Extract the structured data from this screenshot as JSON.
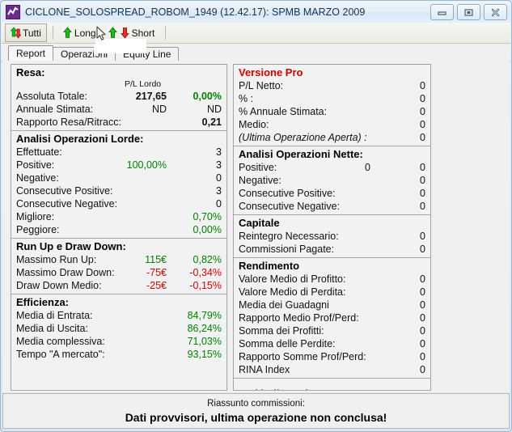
{
  "window": {
    "title": "CICLONE_SOLOSPREAD_ROBOM_1949 (12.42.17): SPMB MARZO 2009",
    "icon": "chart-line-icon",
    "buttons": {
      "minimize": "minimize-icon",
      "maximize": "maximize-icon",
      "close": "close-icon"
    }
  },
  "toolbar": {
    "items": [
      {
        "label": "Tutti",
        "icon": "up-down-arrow-icon",
        "pressed": true
      },
      {
        "label": "Long",
        "icon": "up-arrow-icon",
        "pressed": false
      },
      {
        "label": "Short",
        "icon": "up-down-arrow-icon",
        "pressed": false
      }
    ]
  },
  "tabs": [
    {
      "label": "Report",
      "active": true
    },
    {
      "label": "Operazioni",
      "active": false
    },
    {
      "label": "Equity Line",
      "active": false
    }
  ],
  "left_panel": {
    "groups": [
      {
        "heading": "Resa:",
        "col_header": "P/L Lordo",
        "rows": [
          {
            "label": "Assoluta Totale:",
            "mid": "217,65",
            "mid_bold": true,
            "val": "0,00%",
            "val_class": "green bold"
          },
          {
            "label": "Annuale Stimata:",
            "mid": "ND",
            "mid_bold": false,
            "val": "ND",
            "val_class": ""
          },
          {
            "label": "Rapporto Resa/Ritracc:",
            "mid": "",
            "mid_bold": false,
            "val": "0,21",
            "val_class": "bold"
          }
        ]
      },
      {
        "heading": "Analisi Operazioni Lorde:",
        "rows": [
          {
            "label": "Effettuate:",
            "mid": "",
            "val": "3",
            "val_class": ""
          },
          {
            "label": "Positive:",
            "mid": "100,00%",
            "mid_class": "green",
            "val": "3",
            "val_class": ""
          },
          {
            "label": "Negative:",
            "mid": "",
            "val": "0",
            "val_class": ""
          },
          {
            "label": "Consecutive Positive:",
            "mid": "",
            "val": "3",
            "val_class": ""
          },
          {
            "label": "Consecutive Negative:",
            "mid": "",
            "val": "0",
            "val_class": ""
          },
          {
            "label": "Migliore:",
            "mid": "",
            "val": "0,70%",
            "val_class": "green"
          },
          {
            "label": "Peggiore:",
            "mid": "",
            "val": "0,00%",
            "val_class": "green"
          }
        ]
      },
      {
        "heading": "Run Up e Draw Down:",
        "rows": [
          {
            "label": "Massimo Run Up:",
            "mid": "115€",
            "mid_class": "green",
            "val": "0,82%",
            "val_class": "green"
          },
          {
            "label": "Massimo Draw Down:",
            "mid": "-75€",
            "mid_class": "red",
            "val": "-0,34%",
            "val_class": "red"
          },
          {
            "label": "Draw Down Medio:",
            "mid": "-25€",
            "mid_class": "red",
            "val": "-0,15%",
            "val_class": "red"
          }
        ]
      },
      {
        "heading": "Efficienza:",
        "rows": [
          {
            "label": "Media di Entrata:",
            "mid": "",
            "val": "84,79%",
            "val_class": "green"
          },
          {
            "label": "Media di Uscita:",
            "mid": "",
            "val": "86,24%",
            "val_class": "green"
          },
          {
            "label": "Media complessiva:",
            "mid": "",
            "val": "71,03%",
            "val_class": "green"
          },
          {
            "label": "Tempo \"A mercato\":",
            "mid": "",
            "val": "93,15%",
            "val_class": "green"
          }
        ]
      }
    ]
  },
  "right_panel": {
    "groups": [
      {
        "heading": "Versione Pro",
        "heading_class": "red",
        "rows": [
          {
            "label": "P/L Netto:",
            "mid": "",
            "val": "0"
          },
          {
            "label": "% :",
            "mid": "",
            "val": "0"
          },
          {
            "label": "% Annuale Stimata:",
            "mid": "",
            "val": "0"
          },
          {
            "label": "Medio:",
            "mid": "",
            "val": "0"
          },
          {
            "label": "(Ultima Operazione Aperta) :",
            "mid": "",
            "val": "0",
            "label_class": "ital"
          }
        ]
      },
      {
        "heading": "Analisi Operazioni Nette:",
        "rows": [
          {
            "label": "Positive:",
            "mid": "0",
            "val": "0"
          },
          {
            "label": "Negative:",
            "mid": "",
            "val": "0"
          },
          {
            "label": "Consecutive Positive:",
            "mid": "",
            "val": "0"
          },
          {
            "label": "Consecutive Negative:",
            "mid": "",
            "val": "0"
          }
        ]
      },
      {
        "heading": "Capitale",
        "rows": [
          {
            "label": "Reintegro Necessario:",
            "mid": "",
            "val": "0"
          },
          {
            "label": "Commissioni Pagate:",
            "mid": "",
            "val": "0"
          }
        ]
      },
      {
        "heading": "Rendimento",
        "rows": [
          {
            "label": "Valore Medio di Profitto:",
            "mid": "",
            "val": "0"
          },
          {
            "label": "Valore Medio di Perdita:",
            "mid": "",
            "val": "0"
          },
          {
            "label": "Media dei Guadagni",
            "mid": "",
            "val": "0"
          },
          {
            "label": "Rapporto Medio Prof/Perd:",
            "mid": "",
            "val": "0"
          },
          {
            "label": "Somma dei Profitti:",
            "mid": "",
            "val": "0"
          },
          {
            "label": "Somma delle Perdite:",
            "mid": "",
            "val": "0"
          },
          {
            "label": "Rapporto Somme Prof/Perd:",
            "mid": "",
            "val": "0"
          },
          {
            "label": "RINA Index",
            "mid": "",
            "val": "0"
          }
        ]
      },
      {
        "heading": "Vari indicatori",
        "rows": []
      }
    ]
  },
  "status": {
    "line1": "Riassunto commissioni:",
    "line2": "Dati provvisori, ultima operazione non conclusa!"
  },
  "colors": {
    "positive": "#008000",
    "negative": "#d00000",
    "pro_heading": "#d00000",
    "title_text": "#16334d",
    "panel_bg": "#f2f2f2"
  }
}
